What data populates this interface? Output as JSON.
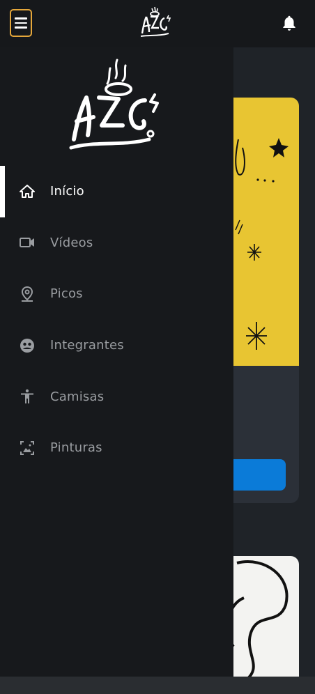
{
  "header": {
    "menu_icon": "hamburger-menu-icon",
    "logo": "hzc-graffiti-logo",
    "notification_icon": "bell-icon"
  },
  "drawer": {
    "logo": "hzc-graffiti-logo",
    "items": [
      {
        "label": "Início",
        "icon": "home-icon",
        "active": true
      },
      {
        "label": "Vídeos",
        "icon": "video-camera-icon",
        "active": false
      },
      {
        "label": "Picos",
        "icon": "location-pin-icon",
        "active": false
      },
      {
        "label": "Integrantes",
        "icon": "group-face-icon",
        "active": false
      },
      {
        "label": "Camisas",
        "icon": "person-icon",
        "active": false
      },
      {
        "label": "Pinturas",
        "icon": "image-frame-icon",
        "active": false
      }
    ]
  },
  "colors": {
    "accent": "#e5a73b",
    "drawer_bg": "#17191c",
    "active_text": "#ffffff",
    "inactive_text": "#9a9da1",
    "card_yellow": "#e8c532",
    "button_blue": "#0b7bd8"
  }
}
